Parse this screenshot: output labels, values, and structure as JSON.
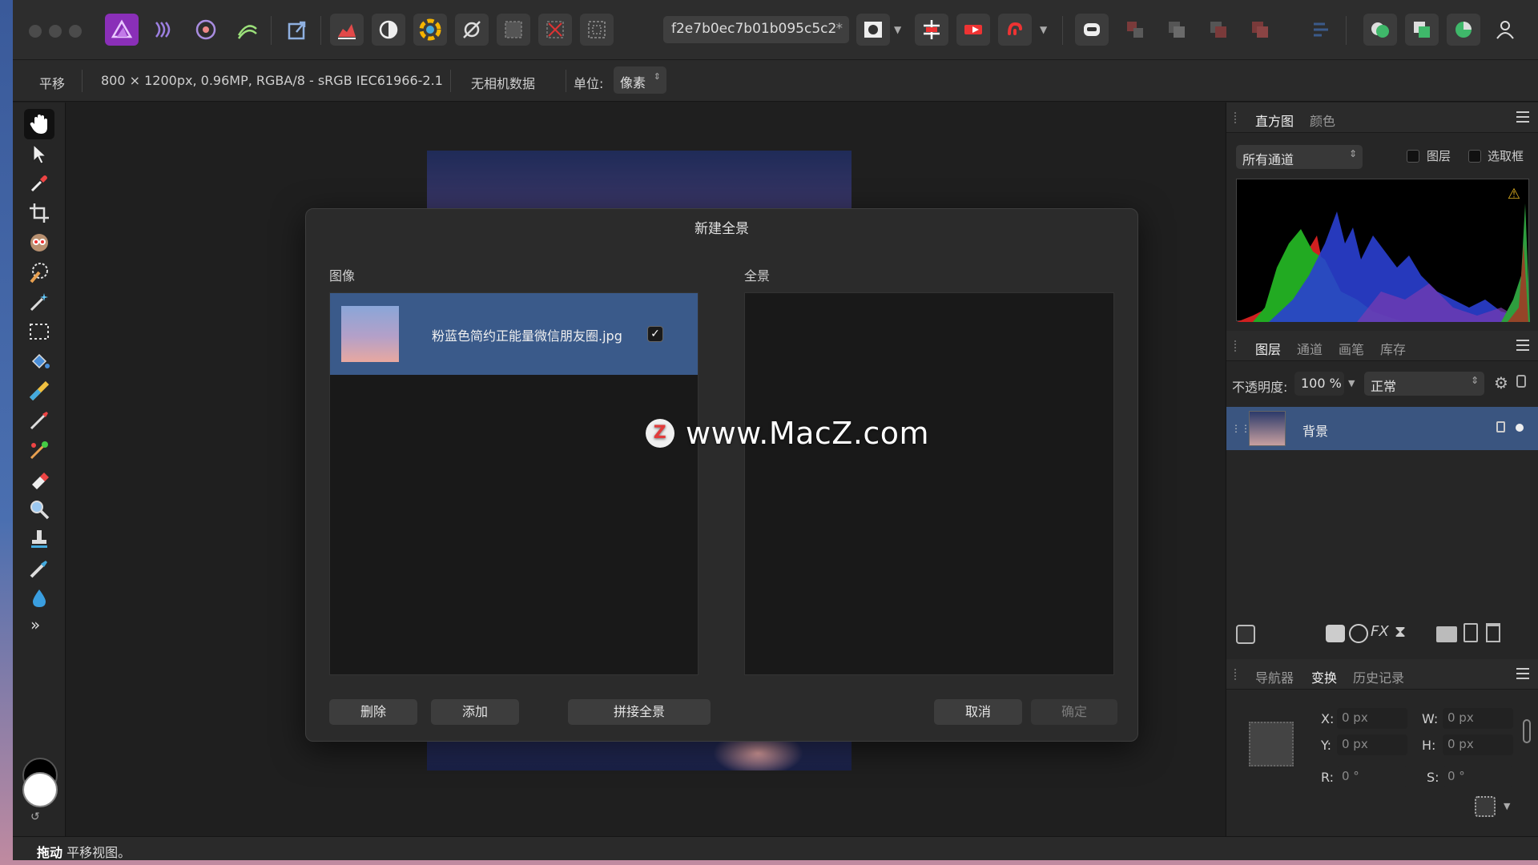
{
  "toolbar": {
    "doc_name": "f2e7b0ec7b01b095c5c2",
    "doc_modified_marker": "*"
  },
  "context_bar": {
    "tool": "平移",
    "doc_info": "800 × 1200px, 0.96MP, RGBA/8 - sRGB IEC61966-2.1",
    "camera": "无相机数据",
    "unit_label": "单位:",
    "unit_value": "像素"
  },
  "dialog": {
    "title": "新建全景",
    "images_label": "图像",
    "panorama_label": "全景",
    "images": [
      {
        "name": "粉蓝色简约正能量微信朋友圈.jpg",
        "checked": true
      }
    ],
    "buttons": {
      "delete": "删除",
      "add": "添加",
      "stitch": "拼接全景",
      "cancel": "取消",
      "ok": "确定"
    }
  },
  "watermark": {
    "logo_letter": "Z",
    "text": "www.MacZ.com"
  },
  "histogram_panel": {
    "tabs": [
      "直方图",
      "颜色"
    ],
    "active_tab": "直方图",
    "channel": "所有通道",
    "check_layer": "图层",
    "check_selection": "选取框",
    "warning_icon": "warning-icon"
  },
  "layers_panel": {
    "tabs": [
      "图层",
      "通道",
      "画笔",
      "库存"
    ],
    "active_tab": "图层",
    "opacity_label": "不透明度:",
    "opacity_value": "100 %",
    "blend_mode": "正常",
    "layers": [
      {
        "name": "背景"
      }
    ]
  },
  "transform_panel": {
    "tabs": [
      "导航器",
      "变换",
      "历史记录"
    ],
    "active_tab": "变换",
    "x_label": "X:",
    "x_value": "0 px",
    "y_label": "Y:",
    "y_value": "0 px",
    "w_label": "W:",
    "w_value": "0 px",
    "h_label": "H:",
    "h_value": "0 px",
    "r_label": "R:",
    "r_value": "0 °",
    "s_label": "S:",
    "s_value": "0 °"
  },
  "status_bar": {
    "action": "拖动",
    "hint": "平移视图。"
  },
  "colors": {
    "accent": "#8a2fb8",
    "selection": "#3a5a8a",
    "panel_bg": "#262626"
  }
}
